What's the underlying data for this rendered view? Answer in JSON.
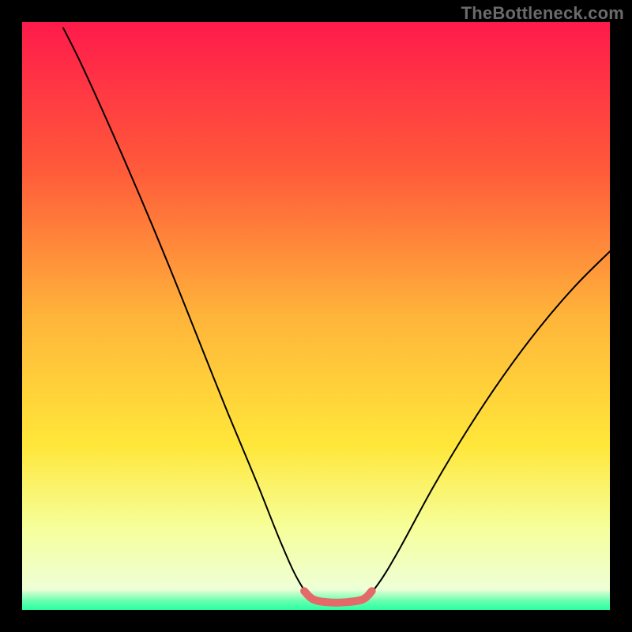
{
  "watermark": "TheBottleneck.com",
  "chart_data": {
    "type": "line",
    "title": "",
    "xlabel": "",
    "ylabel": "",
    "xlim": [
      0,
      100
    ],
    "ylim": [
      0,
      100
    ],
    "background_gradient": {
      "stops": [
        {
          "offset": 0.0,
          "color": "#ff1a4b"
        },
        {
          "offset": 0.25,
          "color": "#ff5a3a"
        },
        {
          "offset": 0.5,
          "color": "#ffb43a"
        },
        {
          "offset": 0.72,
          "color": "#ffe73a"
        },
        {
          "offset": 0.86,
          "color": "#f6ff9a"
        },
        {
          "offset": 0.965,
          "color": "#eeffd6"
        },
        {
          "offset": 0.985,
          "color": "#66ffb0"
        },
        {
          "offset": 1.0,
          "color": "#2bffa0"
        }
      ]
    },
    "series": [
      {
        "name": "bottleneck-curve",
        "stroke": "#000000",
        "stroke_width": 2,
        "points": [
          {
            "x": 7.0,
            "y": 99.0
          },
          {
            "x": 10.0,
            "y": 93.0
          },
          {
            "x": 15.0,
            "y": 82.0
          },
          {
            "x": 20.0,
            "y": 70.5
          },
          {
            "x": 25.0,
            "y": 58.5
          },
          {
            "x": 30.0,
            "y": 46.0
          },
          {
            "x": 35.0,
            "y": 33.5
          },
          {
            "x": 40.0,
            "y": 21.5
          },
          {
            "x": 44.0,
            "y": 11.5
          },
          {
            "x": 47.0,
            "y": 5.0
          },
          {
            "x": 49.5,
            "y": 1.8
          },
          {
            "x": 52.0,
            "y": 1.3
          },
          {
            "x": 55.0,
            "y": 1.3
          },
          {
            "x": 58.0,
            "y": 1.8
          },
          {
            "x": 60.5,
            "y": 4.3
          },
          {
            "x": 64.0,
            "y": 10.0
          },
          {
            "x": 70.0,
            "y": 21.0
          },
          {
            "x": 76.0,
            "y": 31.0
          },
          {
            "x": 82.0,
            "y": 40.0
          },
          {
            "x": 88.0,
            "y": 48.0
          },
          {
            "x": 94.0,
            "y": 55.0
          },
          {
            "x": 100.0,
            "y": 61.0
          }
        ]
      },
      {
        "name": "flat-zone-marker",
        "stroke": "#e46a6a",
        "stroke_width": 10,
        "points": [
          {
            "x": 48.0,
            "y": 3.2
          },
          {
            "x": 49.5,
            "y": 1.8
          },
          {
            "x": 52.0,
            "y": 1.3
          },
          {
            "x": 55.0,
            "y": 1.3
          },
          {
            "x": 58.0,
            "y": 1.8
          },
          {
            "x": 59.5,
            "y": 3.2
          }
        ]
      }
    ]
  }
}
